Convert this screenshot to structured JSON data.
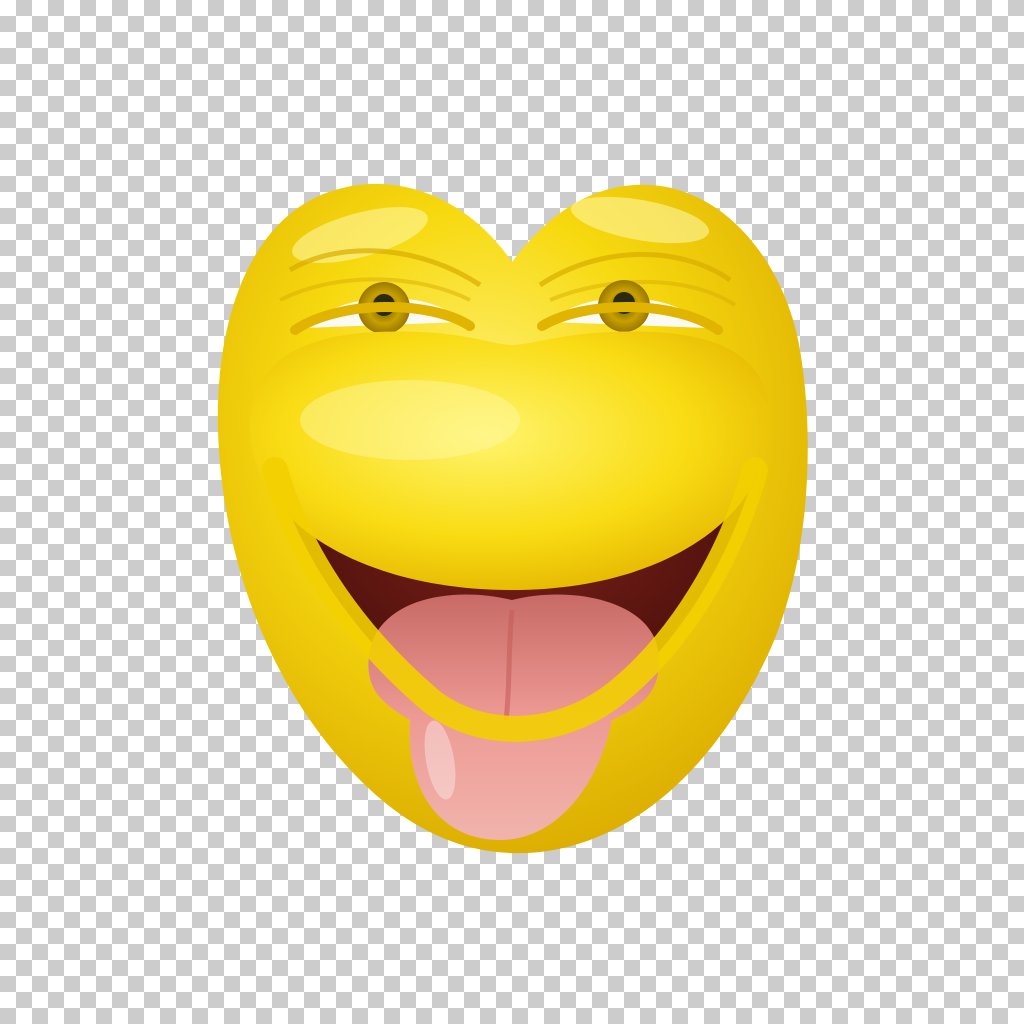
{
  "subject": {
    "icon": "laughing-tongue-out-emoji-icon",
    "colors": {
      "face": "#f7d90f",
      "face_highlight": "#fff27a",
      "face_shadow": "#d4a400",
      "mouth": "#5a1410",
      "tongue": "#e88a86",
      "iris": "#c8a000",
      "pupil": "#2a2a10",
      "eye_white": "#fbfbf3"
    }
  },
  "background": {
    "pattern": "transparency-checkerboard",
    "colors": [
      "#ffffff",
      "#cccccc"
    ]
  }
}
